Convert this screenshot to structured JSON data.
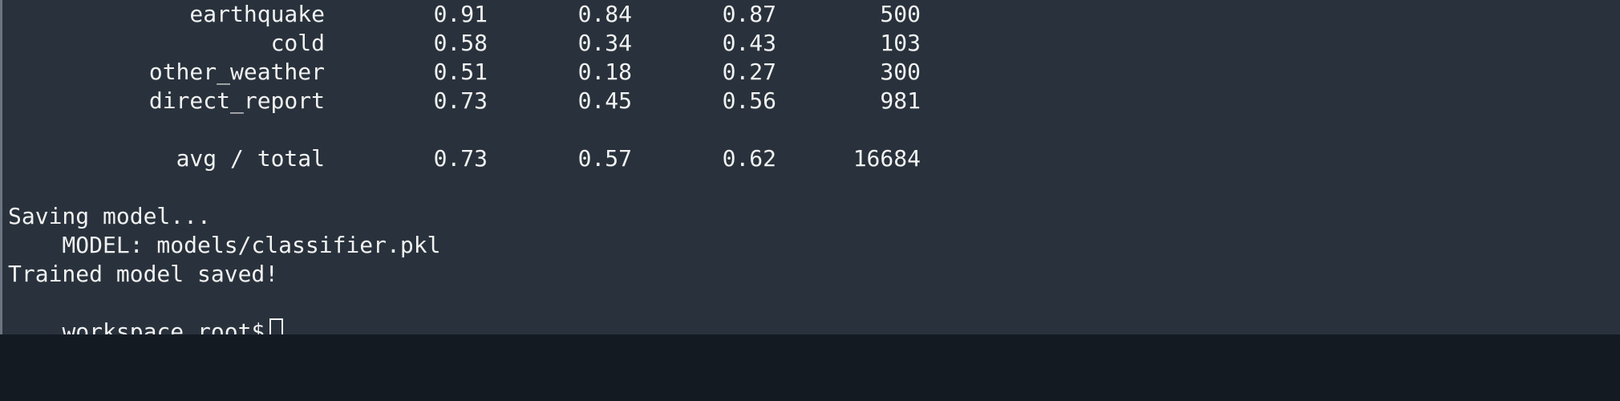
{
  "report": {
    "rows": [
      {
        "label": "earthquake",
        "precision": "0.91",
        "recall": "0.84",
        "f1": "0.87",
        "support": "500"
      },
      {
        "label": "cold",
        "precision": "0.58",
        "recall": "0.34",
        "f1": "0.43",
        "support": "103"
      },
      {
        "label": "other_weather",
        "precision": "0.51",
        "recall": "0.18",
        "f1": "0.27",
        "support": "300"
      },
      {
        "label": "direct_report",
        "precision": "0.73",
        "recall": "0.45",
        "f1": "0.56",
        "support": "981"
      }
    ],
    "total": {
      "label": "avg / total",
      "precision": "0.73",
      "recall": "0.57",
      "f1": "0.62",
      "support": "16684"
    }
  },
  "log": {
    "saving": "Saving model...",
    "model_path": "    MODEL: models/classifier.pkl",
    "saved": "Trained model saved!"
  },
  "prompt": {
    "text": "workspace root$"
  },
  "colors": {
    "terminal_bg": "#29323c",
    "page_bg": "#131a22",
    "text": "#f2f2f2"
  }
}
